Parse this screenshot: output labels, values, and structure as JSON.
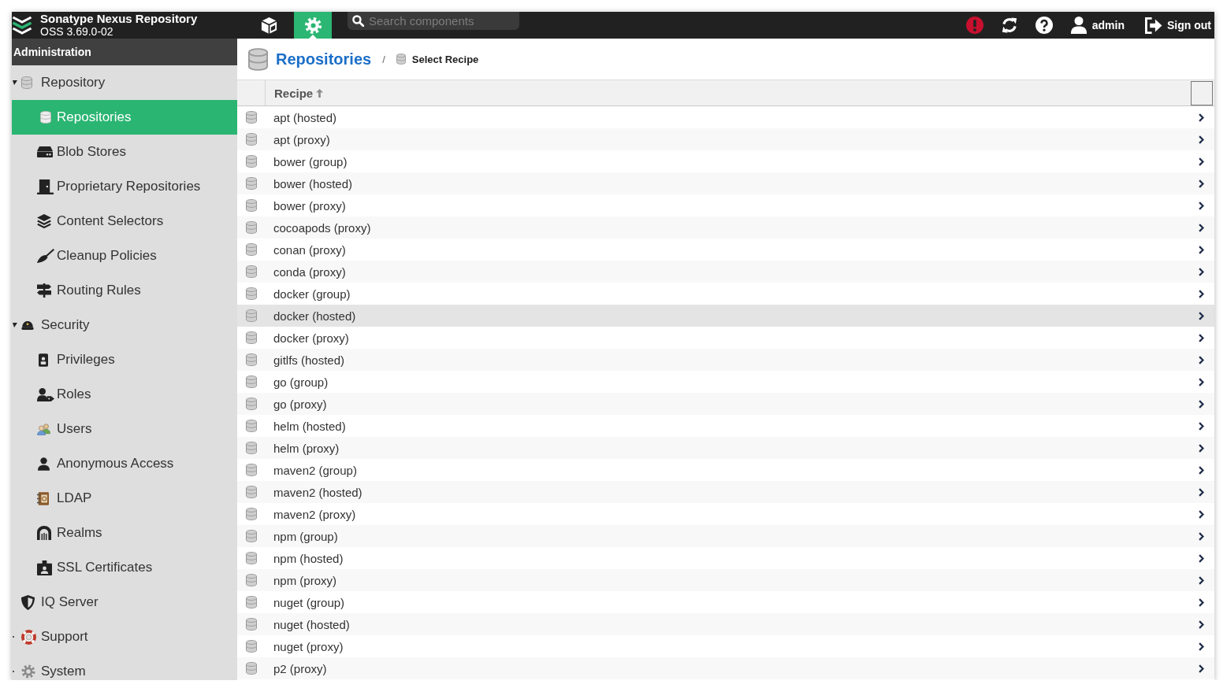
{
  "header": {
    "title": "Sonatype Nexus Repository",
    "version": "OSS 3.69.0-02",
    "modes": [
      {
        "kind": "browse",
        "selected": false
      },
      {
        "kind": "admin",
        "selected": true
      }
    ],
    "search": {
      "placeholder": "Search components"
    },
    "user": "admin",
    "sign_out": "Sign out"
  },
  "sidebar": {
    "title": "Administration",
    "items": [
      {
        "label": "Repository",
        "expanded": true,
        "selected": false,
        "children": [
          {
            "label": "Repositories",
            "selected": true
          },
          {
            "label": "Blob Stores",
            "selected": false
          },
          {
            "label": "Proprietary Repositories",
            "selected": false
          },
          {
            "label": "Content Selectors",
            "selected": false
          },
          {
            "label": "Cleanup Policies",
            "selected": false
          },
          {
            "label": "Routing Rules",
            "selected": false
          }
        ]
      },
      {
        "label": "Security",
        "expanded": true,
        "selected": false,
        "children": [
          {
            "label": "Privileges",
            "selected": false
          },
          {
            "label": "Roles",
            "selected": false
          },
          {
            "label": "Users",
            "selected": false
          },
          {
            "label": "Anonymous Access",
            "selected": false
          },
          {
            "label": "LDAP",
            "selected": false
          },
          {
            "label": "Realms",
            "selected": false
          },
          {
            "label": "SSL Certificates",
            "selected": false
          }
        ]
      },
      {
        "label": "IQ Server",
        "selected": false
      },
      {
        "label": "Support",
        "expanded": false,
        "selected": false
      },
      {
        "label": "System",
        "expanded": false,
        "selected": false
      }
    ]
  },
  "breadcrumb": {
    "title": "Repositories",
    "separator": "/",
    "current": "Select Recipe"
  },
  "table": {
    "columns": [
      {
        "label": "Recipe",
        "sorted": true
      }
    ],
    "rows": [
      {
        "recipe": "apt (hosted)",
        "selected": false
      },
      {
        "recipe": "apt (proxy)",
        "selected": false
      },
      {
        "recipe": "bower (group)",
        "selected": false
      },
      {
        "recipe": "bower (hosted)",
        "selected": false
      },
      {
        "recipe": "bower (proxy)",
        "selected": false
      },
      {
        "recipe": "cocoapods (proxy)",
        "selected": false
      },
      {
        "recipe": "conan (proxy)",
        "selected": false
      },
      {
        "recipe": "conda (proxy)",
        "selected": false
      },
      {
        "recipe": "docker (group)",
        "selected": false
      },
      {
        "recipe": "docker (hosted)",
        "selected": true
      },
      {
        "recipe": "docker (proxy)",
        "selected": false
      },
      {
        "recipe": "gitlfs (hosted)",
        "selected": false
      },
      {
        "recipe": "go (group)",
        "selected": false
      },
      {
        "recipe": "go (proxy)",
        "selected": false
      },
      {
        "recipe": "helm (hosted)",
        "selected": false
      },
      {
        "recipe": "helm (proxy)",
        "selected": false
      },
      {
        "recipe": "maven2 (group)",
        "selected": false
      },
      {
        "recipe": "maven2 (hosted)",
        "selected": false
      },
      {
        "recipe": "maven2 (proxy)",
        "selected": false
      },
      {
        "recipe": "npm (group)",
        "selected": false
      },
      {
        "recipe": "npm (hosted)",
        "selected": false
      },
      {
        "recipe": "npm (proxy)",
        "selected": false
      },
      {
        "recipe": "nuget (group)",
        "selected": false
      },
      {
        "recipe": "nuget (hosted)",
        "selected": false
      },
      {
        "recipe": "nuget (proxy)",
        "selected": false
      },
      {
        "recipe": "p2 (proxy)",
        "selected": false
      }
    ]
  }
}
